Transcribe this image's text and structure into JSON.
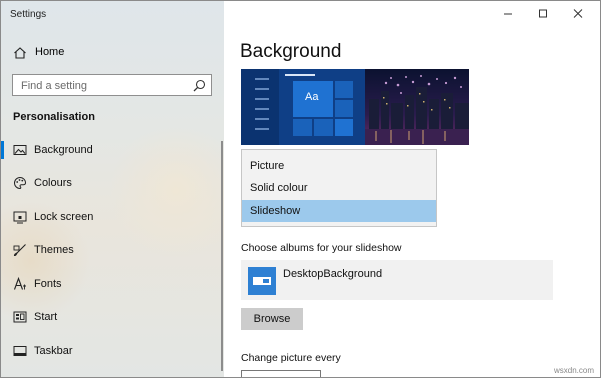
{
  "window": {
    "title": "Settings",
    "controls": {
      "minimize_icon": "minimize-icon",
      "maximize_icon": "maximize-icon",
      "close_icon": "close-icon"
    }
  },
  "sidebar": {
    "home_label": "Home",
    "search_placeholder": "Find a setting",
    "section_title": "Personalisation",
    "items": [
      {
        "label": "Background",
        "icon": "picture-icon",
        "selected": true
      },
      {
        "label": "Colours",
        "icon": "palette-icon"
      },
      {
        "label": "Lock screen",
        "icon": "lock-screen-icon"
      },
      {
        "label": "Themes",
        "icon": "brush-icon"
      },
      {
        "label": "Fonts",
        "icon": "font-icon"
      },
      {
        "label": "Start",
        "icon": "start-icon"
      },
      {
        "label": "Taskbar",
        "icon": "taskbar-icon"
      }
    ]
  },
  "main": {
    "page_title": "Background",
    "preview_tile_text": "Aa",
    "dropdown_options": [
      {
        "label": "Picture"
      },
      {
        "label": "Solid colour"
      },
      {
        "label": "Slideshow",
        "selected": true
      }
    ],
    "albums_label": "Choose albums for your slideshow",
    "album_name": "DesktopBackground",
    "browse_label": "Browse",
    "change_label": "Change picture every"
  },
  "watermark": "wsxdn.com",
  "colors": {
    "accent": "#0078d7",
    "selection": "#9cc9ec",
    "album_tile": "#2e80d3",
    "preview_bg": "#0a2a63"
  }
}
